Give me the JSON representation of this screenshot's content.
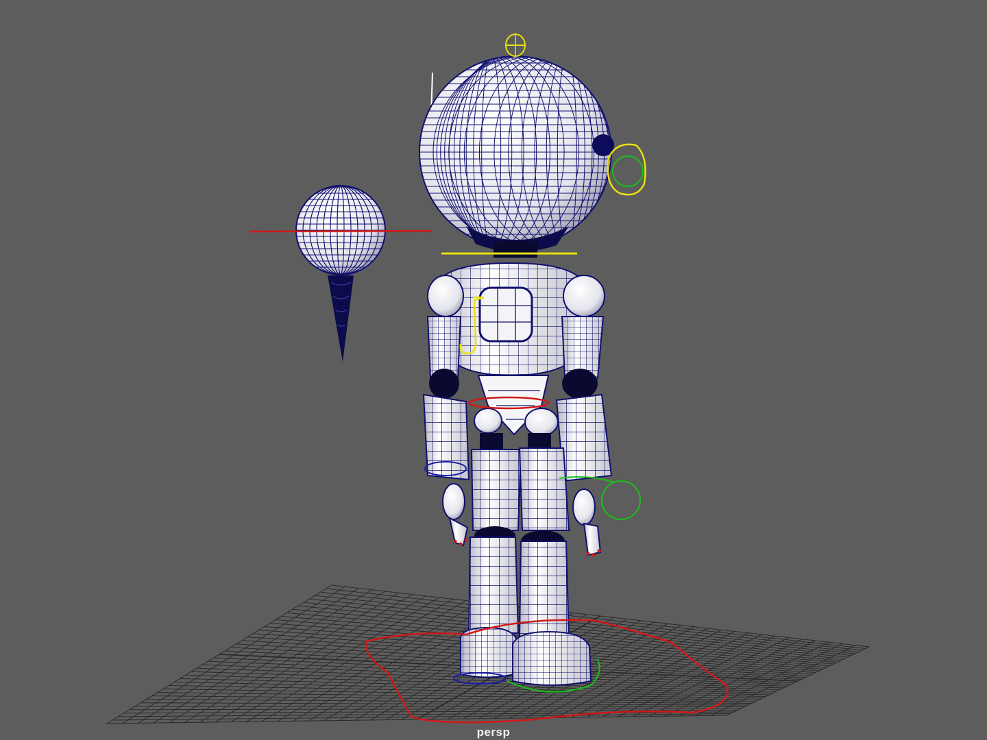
{
  "viewport": {
    "camera_label": "persp",
    "background": "#5d5d5d"
  },
  "colors": {
    "grid": "#2a2a2a",
    "wire": "#10106e",
    "mesh_fill": "#f4f4f6",
    "mesh_shadow": "#c9c9d2",
    "control_red": "#d21818",
    "control_yellow": "#e8e010",
    "control_green": "#18c018",
    "control_blue": "#1a1aa8"
  },
  "scene": {
    "objects": [
      "robot-character-mesh",
      "eye-target-locator",
      "ground-grid"
    ],
    "icons": [
      "head-control-icon",
      "torso-j-control-icon"
    ]
  }
}
